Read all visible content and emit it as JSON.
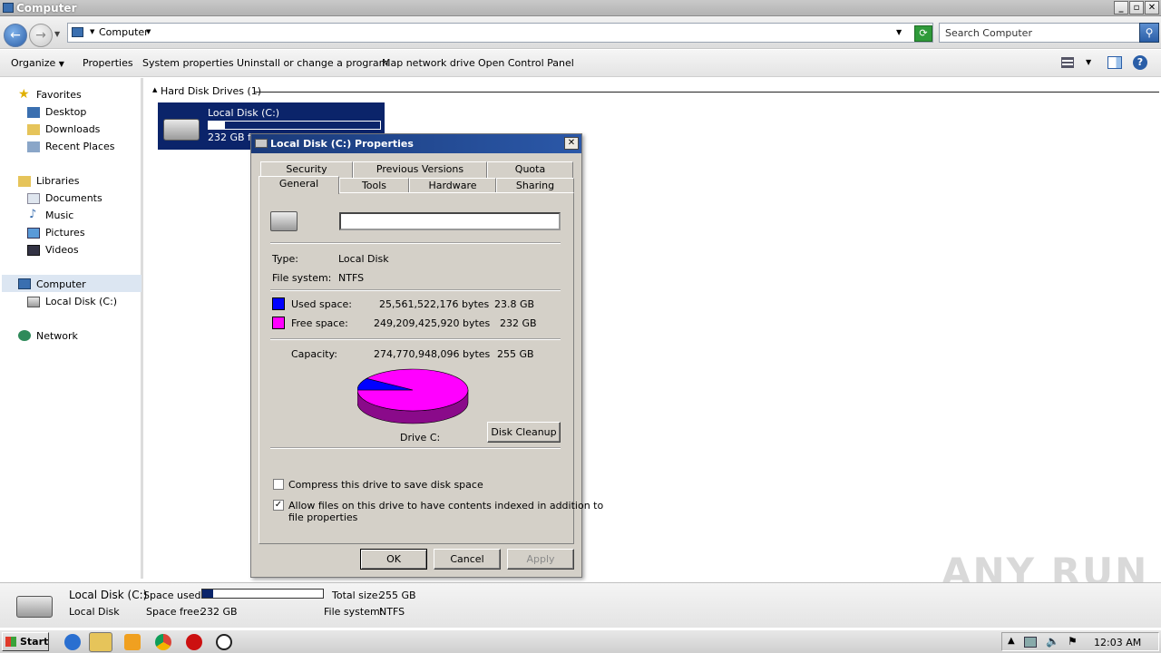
{
  "window": {
    "title": "Computer"
  },
  "address": {
    "path": "Computer",
    "search_placeholder": "Search Computer"
  },
  "toolbar": {
    "organize": "Organize",
    "properties": "Properties",
    "system_properties": "System properties",
    "uninstall": "Uninstall or change a program",
    "map_drive": "Map network drive",
    "control_panel": "Open Control Panel"
  },
  "nav": {
    "favorites": "Favorites",
    "desktop": "Desktop",
    "downloads": "Downloads",
    "recent": "Recent Places",
    "libraries": "Libraries",
    "documents": "Documents",
    "music": "Music",
    "pictures": "Pictures",
    "videos": "Videos",
    "computer": "Computer",
    "local_disk": "Local Disk (C:)",
    "network": "Network"
  },
  "content": {
    "group": "Hard Disk Drives (1)",
    "drive_name": "Local Disk (C:)",
    "drive_free": "232 GB fr",
    "drive_used_fraction": 0.093
  },
  "dialog": {
    "title": "Local Disk (C:) Properties",
    "tabs_back": [
      "Security",
      "Previous Versions",
      "Quota"
    ],
    "tabs_front": [
      "General",
      "Tools",
      "Hardware",
      "Sharing"
    ],
    "label_value": "",
    "type_label": "Type:",
    "type_value": "Local Disk",
    "fs_label": "File system:",
    "fs_value": "NTFS",
    "used_label": "Used space:",
    "used_bytes": "25,561,522,176 bytes",
    "used_gb": "23.8 GB",
    "free_label": "Free space:",
    "free_bytes": "249,209,425,920 bytes",
    "free_gb": "232 GB",
    "cap_label": "Capacity:",
    "cap_bytes": "274,770,948,096 bytes",
    "cap_gb": "255 GB",
    "drive_label": "Drive C:",
    "cleanup": "Disk Cleanup",
    "compress": "Compress this drive to save disk space",
    "index_line1": "Allow files on this drive to have contents indexed in addition to",
    "index_line2": "file properties",
    "compress_checked": false,
    "index_checked": true,
    "ok": "OK",
    "cancel": "Cancel",
    "apply": "Apply",
    "used_color": "#0000ff",
    "free_color": "#ff00ff"
  },
  "details": {
    "name": "Local Disk (C:)",
    "type": "Local Disk",
    "space_used_label": "Space used:",
    "space_free_label": "Space free:",
    "space_free": "232 GB",
    "total_label": "Total size:",
    "total": "255 GB",
    "fs_label": "File system:",
    "fs": "NTFS",
    "used_fraction": 0.093
  },
  "taskbar": {
    "start": "Start",
    "clock": "12:03 AM"
  },
  "watermark": "ANY RUN"
}
